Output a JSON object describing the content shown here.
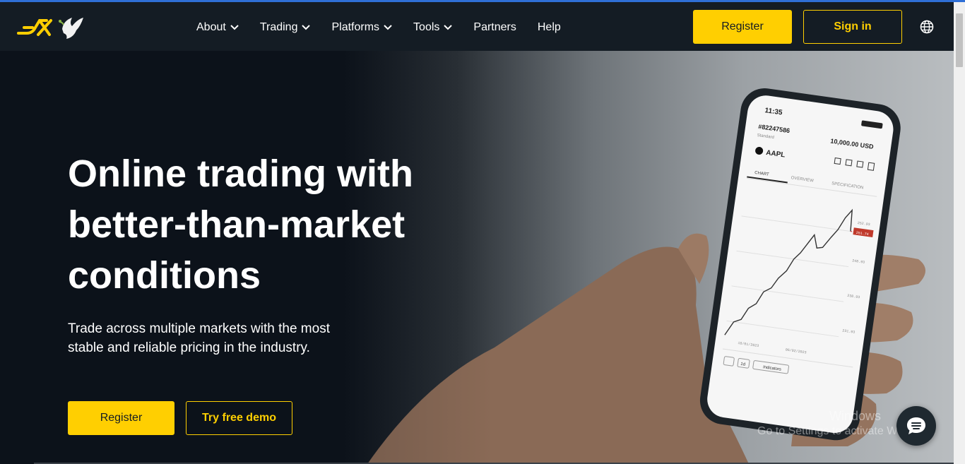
{
  "header": {
    "nav": [
      {
        "label": "About",
        "has_dropdown": true
      },
      {
        "label": "Trading",
        "has_dropdown": true
      },
      {
        "label": "Platforms",
        "has_dropdown": true
      },
      {
        "label": "Tools",
        "has_dropdown": true
      },
      {
        "label": "Partners",
        "has_dropdown": false
      },
      {
        "label": "Help",
        "has_dropdown": false
      }
    ],
    "register_label": "Register",
    "signin_label": "Sign in",
    "language_icon": "globe-icon"
  },
  "hero": {
    "title": "Online trading with better-than-market conditions",
    "subtitle": "Trade across multiple markets with the most stable and reliable pricing in the industry.",
    "register_label": "Register",
    "demo_label": "Try free demo"
  },
  "phone": {
    "time": "11:35",
    "account": "#82247586",
    "account_type": "Standard",
    "balance": "10,000.00 USD",
    "symbol": "AAPL",
    "tabs": [
      "CHART",
      "OVERVIEW",
      "SPECIFICATION"
    ],
    "price_labels": [
      "252.93",
      "251.74",
      "248.93",
      "238.93",
      "231.93"
    ],
    "dates": [
      "18/01/2023",
      "06/02/2023"
    ],
    "bottom_items": [
      "1d",
      "Indicators"
    ]
  },
  "watermark": {
    "line1": "Windows",
    "line2": "Go to Settings to activate Windows."
  },
  "colors": {
    "accent": "#ffcf01",
    "header_bg": "#141c24",
    "hero_dark": "#0c121a"
  },
  "icons": {
    "logo": "exness-logo",
    "dove": "dove-icon",
    "chat": "chat-icon"
  }
}
